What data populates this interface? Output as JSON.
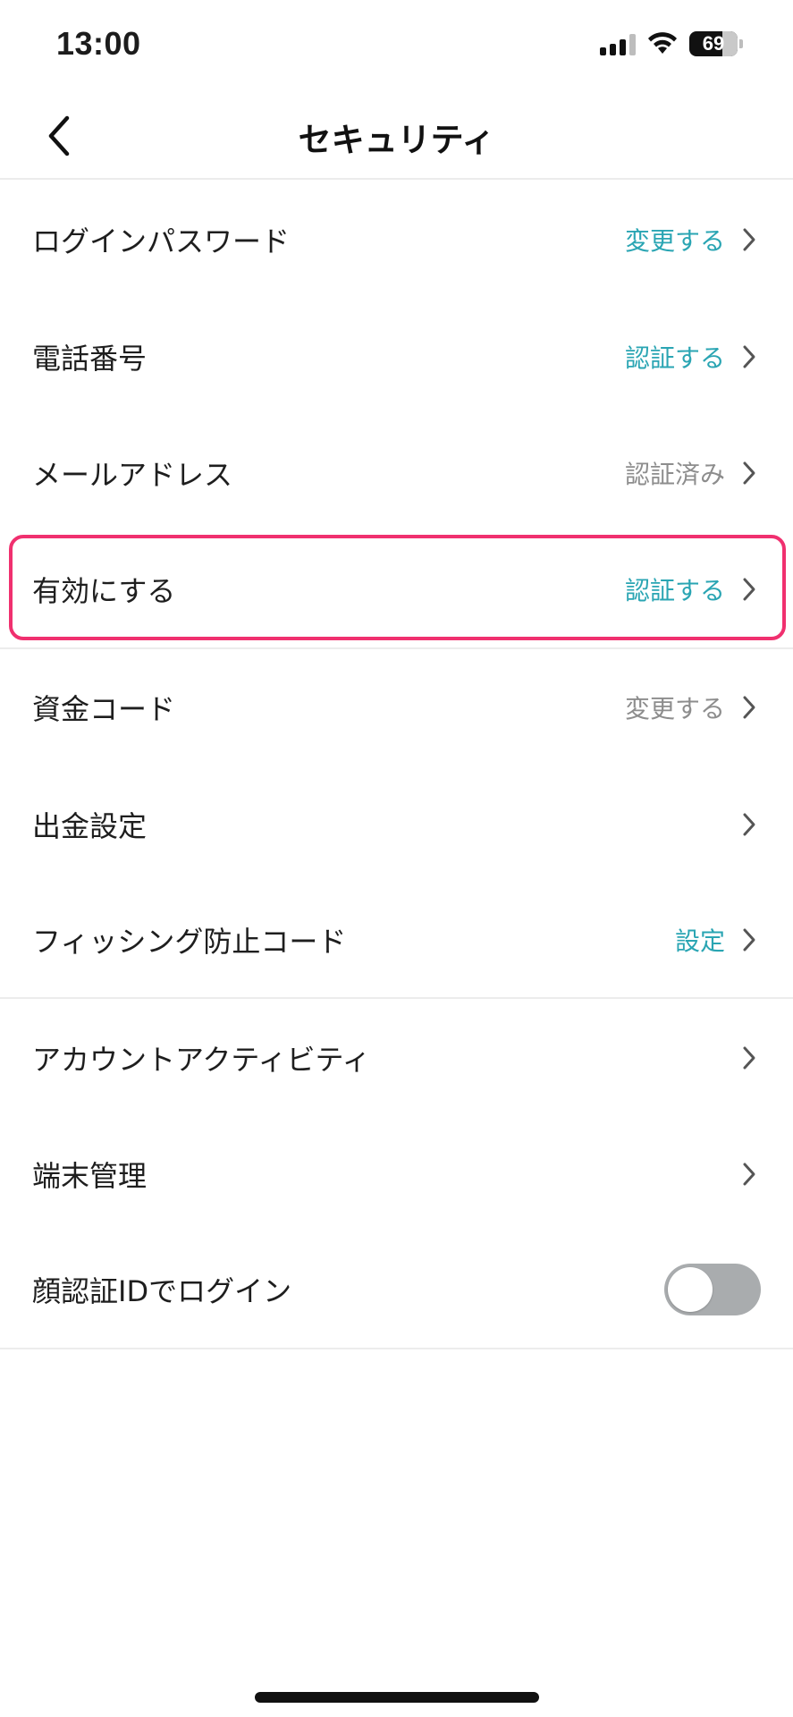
{
  "status_bar": {
    "time": "13:00",
    "battery": "69"
  },
  "header": {
    "title": "セキュリティ",
    "back_icon": "chevron-left-icon"
  },
  "rows": [
    {
      "label": "ログインパスワード",
      "value": "変更する",
      "value_style": "accent"
    },
    {
      "label": "電話番号",
      "value": "認証する",
      "value_style": "accent"
    },
    {
      "label": "メールアドレス",
      "value": "認証済み",
      "value_style": "muted"
    },
    {
      "label": "有効にする",
      "value": "認証する",
      "value_style": "accent",
      "highlighted": true
    },
    {
      "label": "資金コード",
      "value": "変更する",
      "value_style": "muted"
    },
    {
      "label": "出金設定",
      "value": ""
    },
    {
      "label": "フィッシング防止コード",
      "value": "設定",
      "value_style": "accent"
    },
    {
      "label": "アカウントアクティビティ",
      "value": ""
    },
    {
      "label": "端末管理",
      "value": ""
    },
    {
      "label": "顔認証IDでログイン",
      "toggle": false
    }
  ],
  "colors": {
    "accent": "#2aa5b3",
    "muted": "#8d8d8d",
    "highlight": "#f0306f",
    "toggle_off": "#a9acae"
  }
}
